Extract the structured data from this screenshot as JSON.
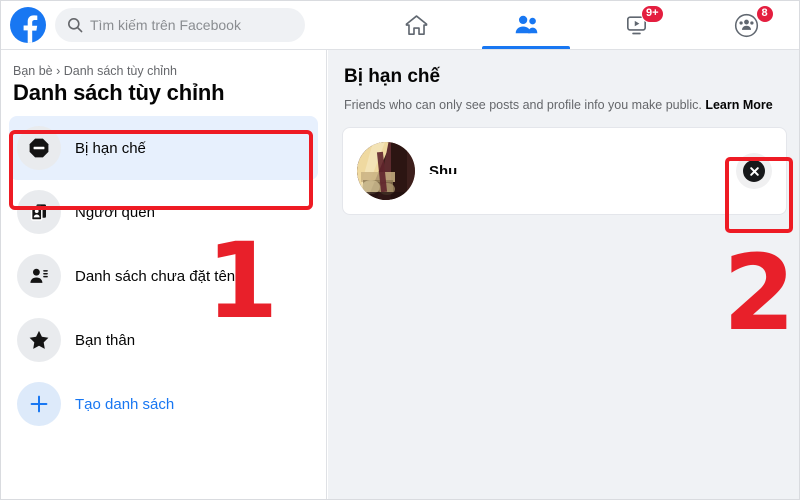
{
  "topbar": {
    "logo_icon": "facebook-logo-icon",
    "search": {
      "icon": "search-icon",
      "placeholder": "Tìm kiếm trên Facebook",
      "value": ""
    },
    "nav": [
      {
        "name": "home",
        "icon": "home-icon",
        "active": false,
        "badge": ""
      },
      {
        "name": "friends",
        "icon": "friends-icon",
        "active": true,
        "badge": ""
      },
      {
        "name": "watch",
        "icon": "watch-video-icon",
        "active": false,
        "badge": "9+"
      },
      {
        "name": "groups",
        "icon": "groups-icon",
        "active": false,
        "badge": "8"
      }
    ]
  },
  "sidebar": {
    "breadcrumb": "Bạn bè › Danh sách tùy chỉnh",
    "title": "Danh sách tùy chỉnh",
    "items": [
      {
        "label": "Bị hạn chế",
        "icon": "restricted-octagon-icon",
        "selected": true
      },
      {
        "label": "Người quen",
        "icon": "contact-card-icon",
        "selected": false
      },
      {
        "label": "Danh sách chưa đặt tên",
        "icon": "person-list-icon",
        "selected": false
      },
      {
        "label": "Bạn thân",
        "icon": "star-icon",
        "selected": false
      }
    ],
    "create": {
      "label": "Tạo danh sách",
      "icon": "plus-icon"
    }
  },
  "main": {
    "title": "Bị hạn chế",
    "description": "Friends who can only see posts and profile info you make public.",
    "learn_more": "Learn More",
    "friends": [
      {
        "name": "Shu",
        "avatar": "friend-avatar-photo",
        "remove_icon": "remove-x-icon"
      }
    ]
  },
  "annotations": {
    "step_one": "1",
    "step_two": "2",
    "highlight_color": "#ee1b24"
  }
}
